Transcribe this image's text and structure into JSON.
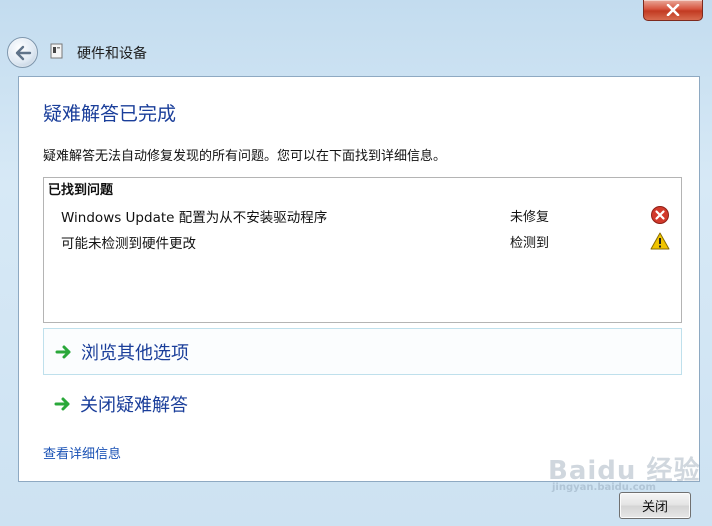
{
  "window": {
    "nav_title": "硬件和设备"
  },
  "page": {
    "title": "疑难解答已完成",
    "summary": "疑难解答无法自动修复发现的所有问题。您可以在下面找到详细信息。"
  },
  "issues": {
    "header": "已找到问题",
    "rows": [
      {
        "name": "Windows Update 配置为从不安装驱动程序",
        "status": "未修复",
        "icon": "error-icon"
      },
      {
        "name": "可能未检测到硬件更改",
        "status": "检测到",
        "icon": "warning-icon"
      }
    ]
  },
  "options": [
    {
      "label": "浏览其他选项"
    },
    {
      "label": "关闭疑难解答"
    }
  ],
  "details_link": "查看详细信息",
  "footer": {
    "close_label": "关闭"
  },
  "watermark": {
    "text": "Baidu 经验",
    "sub": "jingyan.baidu.com"
  },
  "colors": {
    "link": "#1a3e9a",
    "error": "#d23a2c",
    "warning": "#f0c400",
    "arrow": "#2aa83a"
  }
}
